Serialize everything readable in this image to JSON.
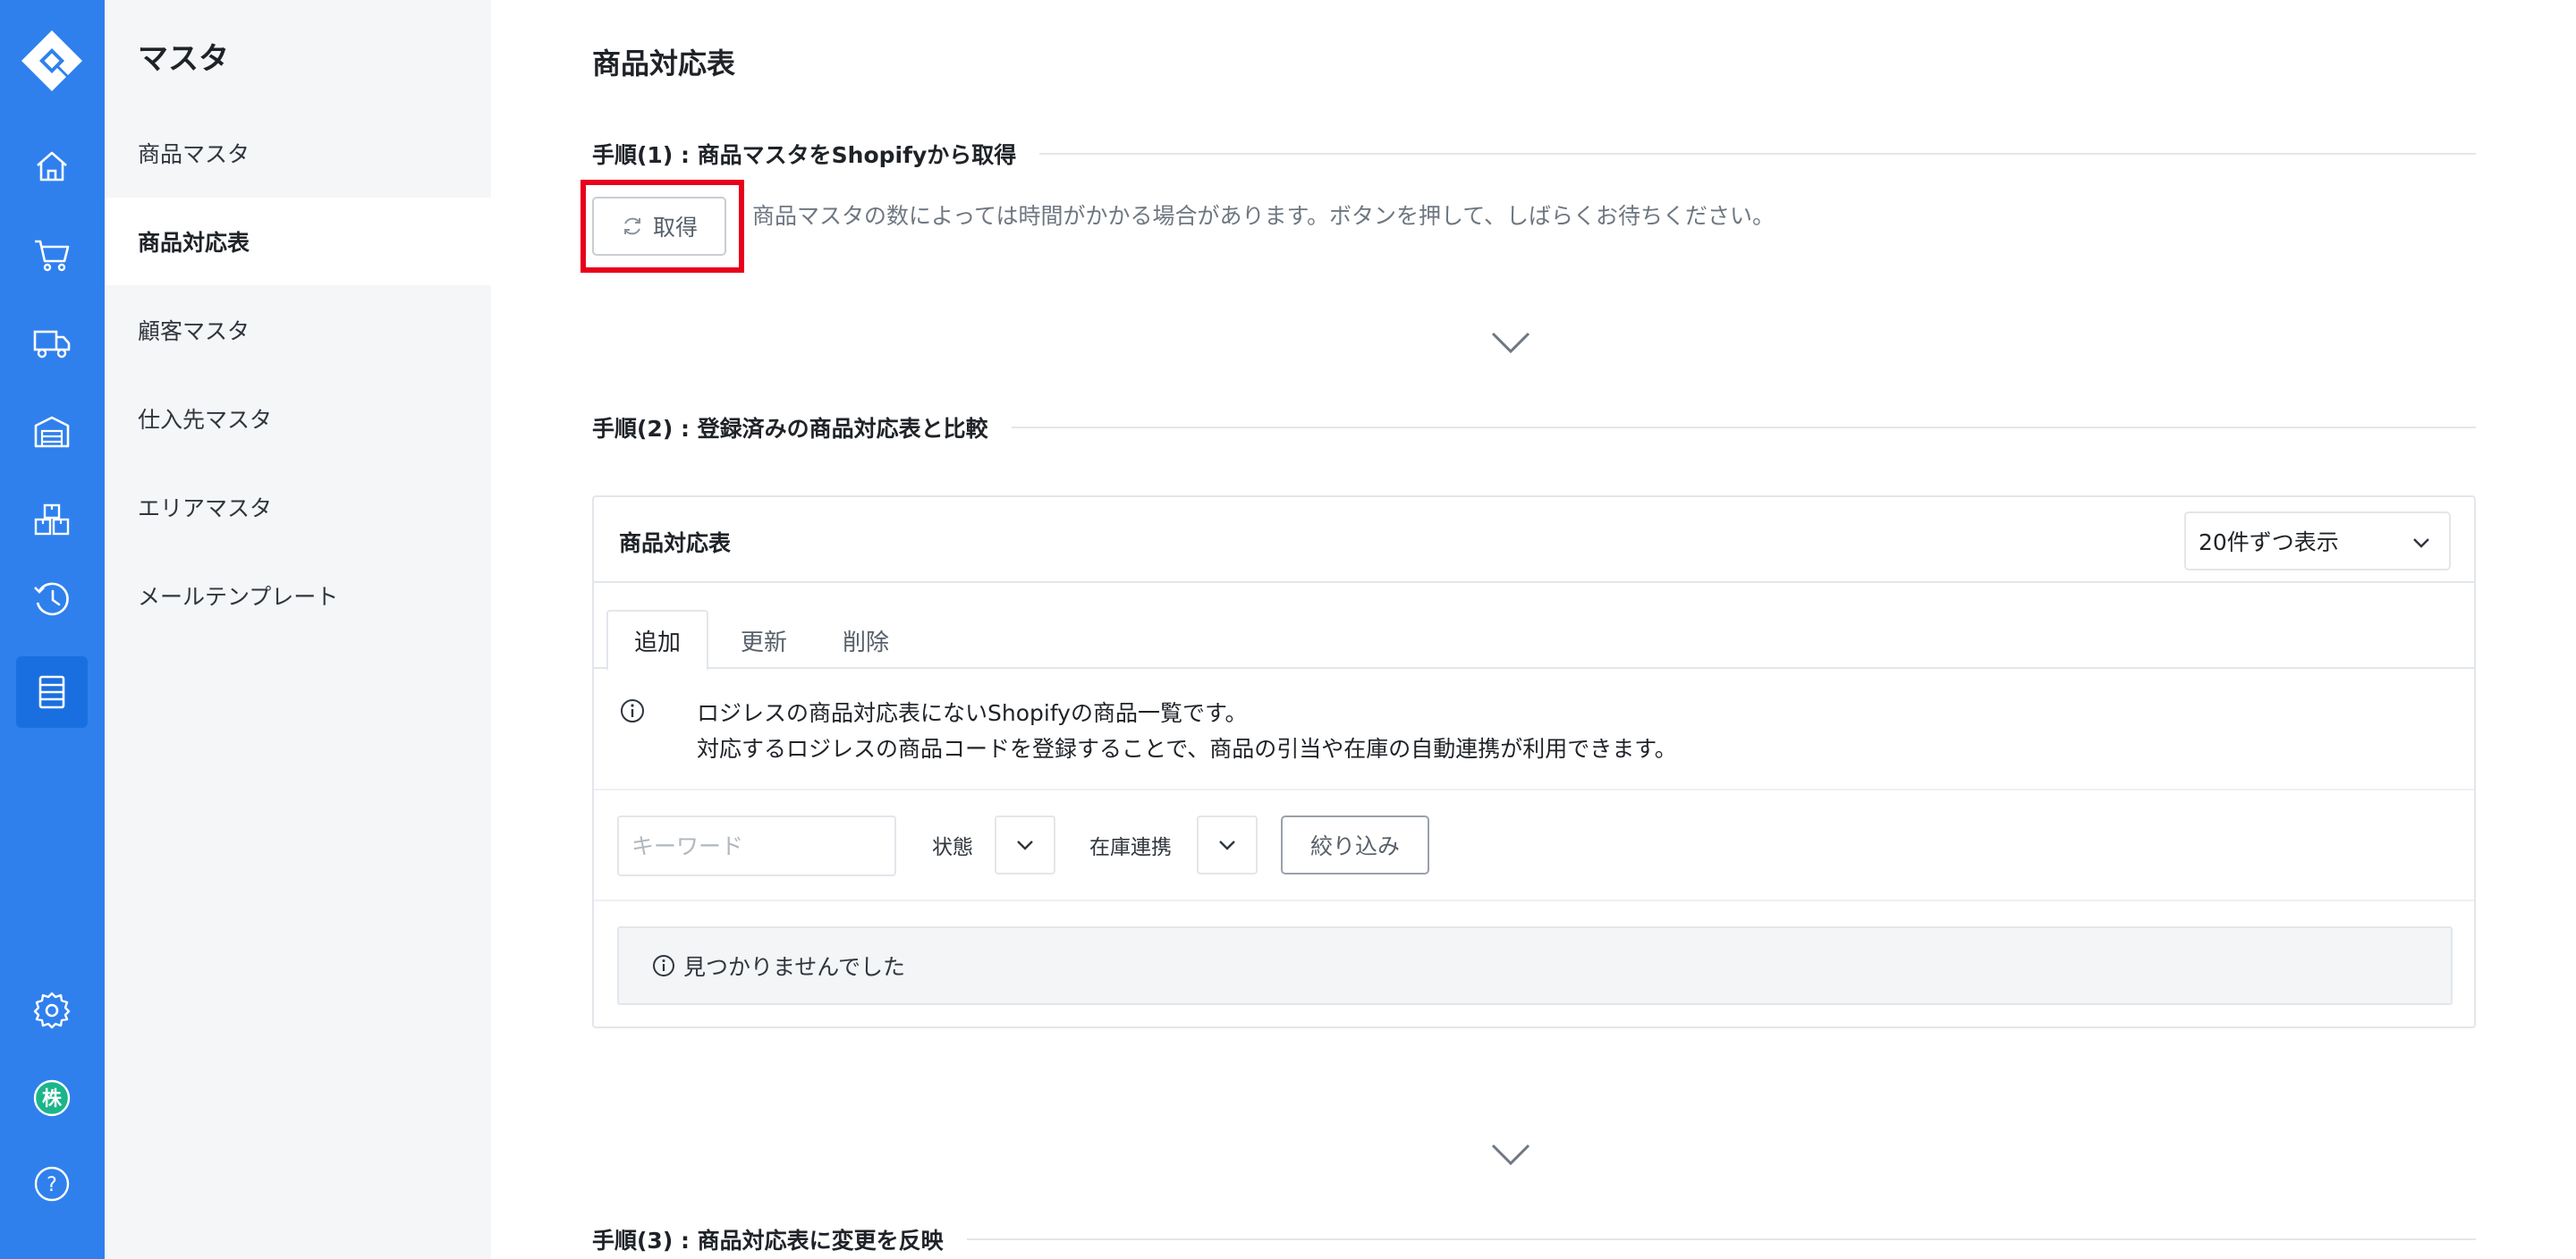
{
  "sidebar": {
    "section_title": "マスタ",
    "items": [
      {
        "label": "商品マスタ",
        "active": false
      },
      {
        "label": "商品対応表",
        "active": true
      },
      {
        "label": "顧客マスタ",
        "active": false
      },
      {
        "label": "仕入先マスタ",
        "active": false
      },
      {
        "label": "エリアマスタ",
        "active": false
      },
      {
        "label": "メールテンプレート",
        "active": false
      }
    ]
  },
  "rail": {
    "icons": [
      "logo-icon",
      "home-icon",
      "cart-icon",
      "truck-icon",
      "warehouse-icon",
      "boxes-icon",
      "history-icon",
      "master-list-icon",
      "settings-icon",
      "company-avatar-icon",
      "help-icon"
    ],
    "avatar_text": "株",
    "help_text": "?"
  },
  "page": {
    "title": "商品対応表"
  },
  "step1": {
    "label": "手順(1) : 商品マスタをShopifyから取得",
    "button_label": "取得",
    "hint": "商品マスタの数によっては時間がかかる場合があります。ボタンを押して、しばらくお待ちください。"
  },
  "step2": {
    "label": "手順(2) : 登録済みの商品対応表と比較"
  },
  "step3": {
    "label": "手順(3) : 商品対応表に変更を反映"
  },
  "card": {
    "title": "商品対応表",
    "per_page": "20件ずつ表示",
    "tabs": [
      {
        "label": "追加",
        "active": true
      },
      {
        "label": "更新",
        "active": false
      },
      {
        "label": "削除",
        "active": false
      }
    ],
    "info_line1": "ロジレスの商品対応表にないShopifyの商品一覧です。",
    "info_line2": "対応するロジレスの商品コードを登録することで、商品の引当や在庫の自動連携が利用できます。",
    "keyword_placeholder": "キーワード",
    "status_label": "状態",
    "stock_link_label": "在庫連携",
    "filter_button": "絞り込み",
    "empty_message": "見つかりませんでした"
  },
  "colors": {
    "rail": "#2f80ed",
    "highlight_box": "#e8001c",
    "avatar": "#1bb58a"
  }
}
